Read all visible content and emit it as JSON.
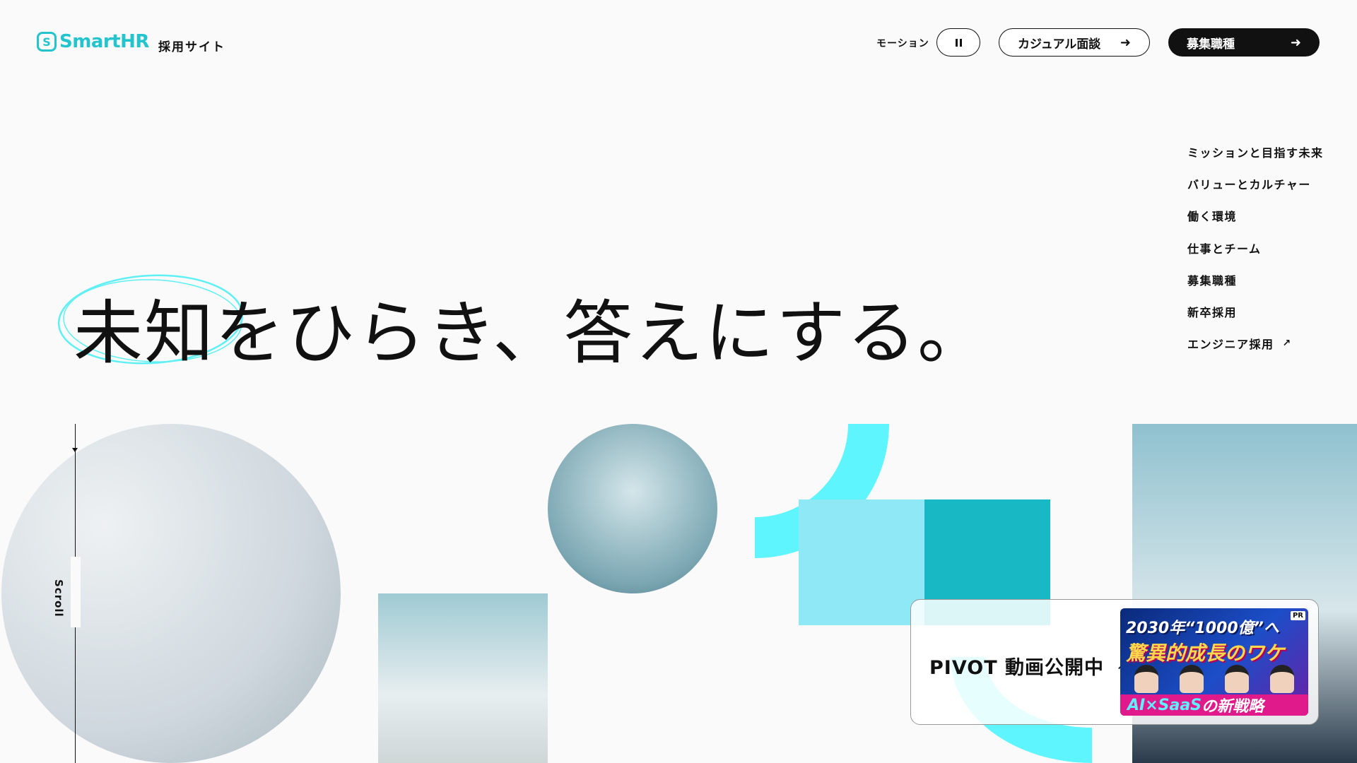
{
  "header": {
    "logo_text": "SmartHR",
    "logo_mark": "S",
    "site_label": "採用サイト",
    "motion_label": "モーション",
    "casual_button": "カジュアル面談",
    "jobs_button": "募集職種",
    "arrow": "➜"
  },
  "side_nav": {
    "items": [
      {
        "label": "ミッションと目指す未来"
      },
      {
        "label": "バリューとカルチャー"
      },
      {
        "label": "働く環境"
      },
      {
        "label": "仕事とチーム"
      },
      {
        "label": "募集職種"
      },
      {
        "label": "新卒採用"
      },
      {
        "label": "エンジニア採用",
        "external_icon": "↗"
      }
    ]
  },
  "hero": {
    "headline": "未知をひらき、答えにする。",
    "scroll_label": "Scroll"
  },
  "pivot": {
    "label": "PIVOT 動画公開中",
    "external_icon": "↗",
    "thumb_badge": "PR",
    "thumb_line1": "2030年“1000億”へ",
    "thumb_line2": "驚異的成長のワケ",
    "thumb_line3_a": "AI×SaaS",
    "thumb_line3_b": "の新戦略"
  },
  "colors": {
    "brand": "#23c4cd",
    "teal": "#18b9c4",
    "light_cyan": "#8fe8f5",
    "bright_cyan": "#5ef5ff",
    "text": "#111111",
    "background": "#fafafa"
  }
}
